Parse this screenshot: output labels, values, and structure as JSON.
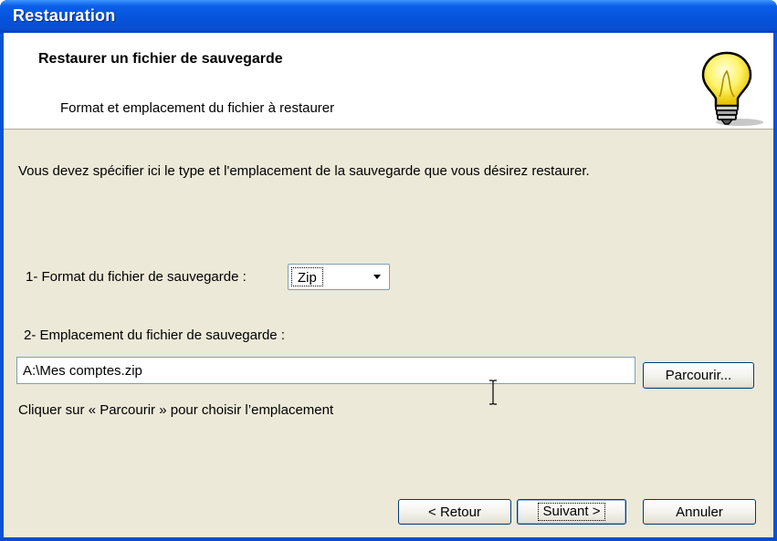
{
  "window": {
    "title": "Restauration"
  },
  "header": {
    "title": "Restaurer un fichier de sauvegarde",
    "subtitle": "Format et emplacement du fichier à restaurer",
    "icon": "lightbulb-icon"
  },
  "intro": "Vous devez spécifier ici le type et l'emplacement de la sauvegarde que vous désirez restaurer.",
  "format": {
    "label": "1- Format du fichier de sauvegarde :",
    "selected": "Zip"
  },
  "location": {
    "label": "2- Emplacement du fichier de sauvegarde :",
    "value": "A:\\Mes comptes.zip",
    "browse_label": "Parcourir...",
    "hint": "Cliquer sur « Parcourir » pour choisir l’emplacement"
  },
  "buttons": {
    "back": "< Retour",
    "next": "Suivant >",
    "cancel": "Annuler"
  },
  "colors": {
    "titlebar": "#0553dd",
    "client_bg": "#ece9d8",
    "header_bg": "#ffffff",
    "button_border": "#003c74"
  }
}
